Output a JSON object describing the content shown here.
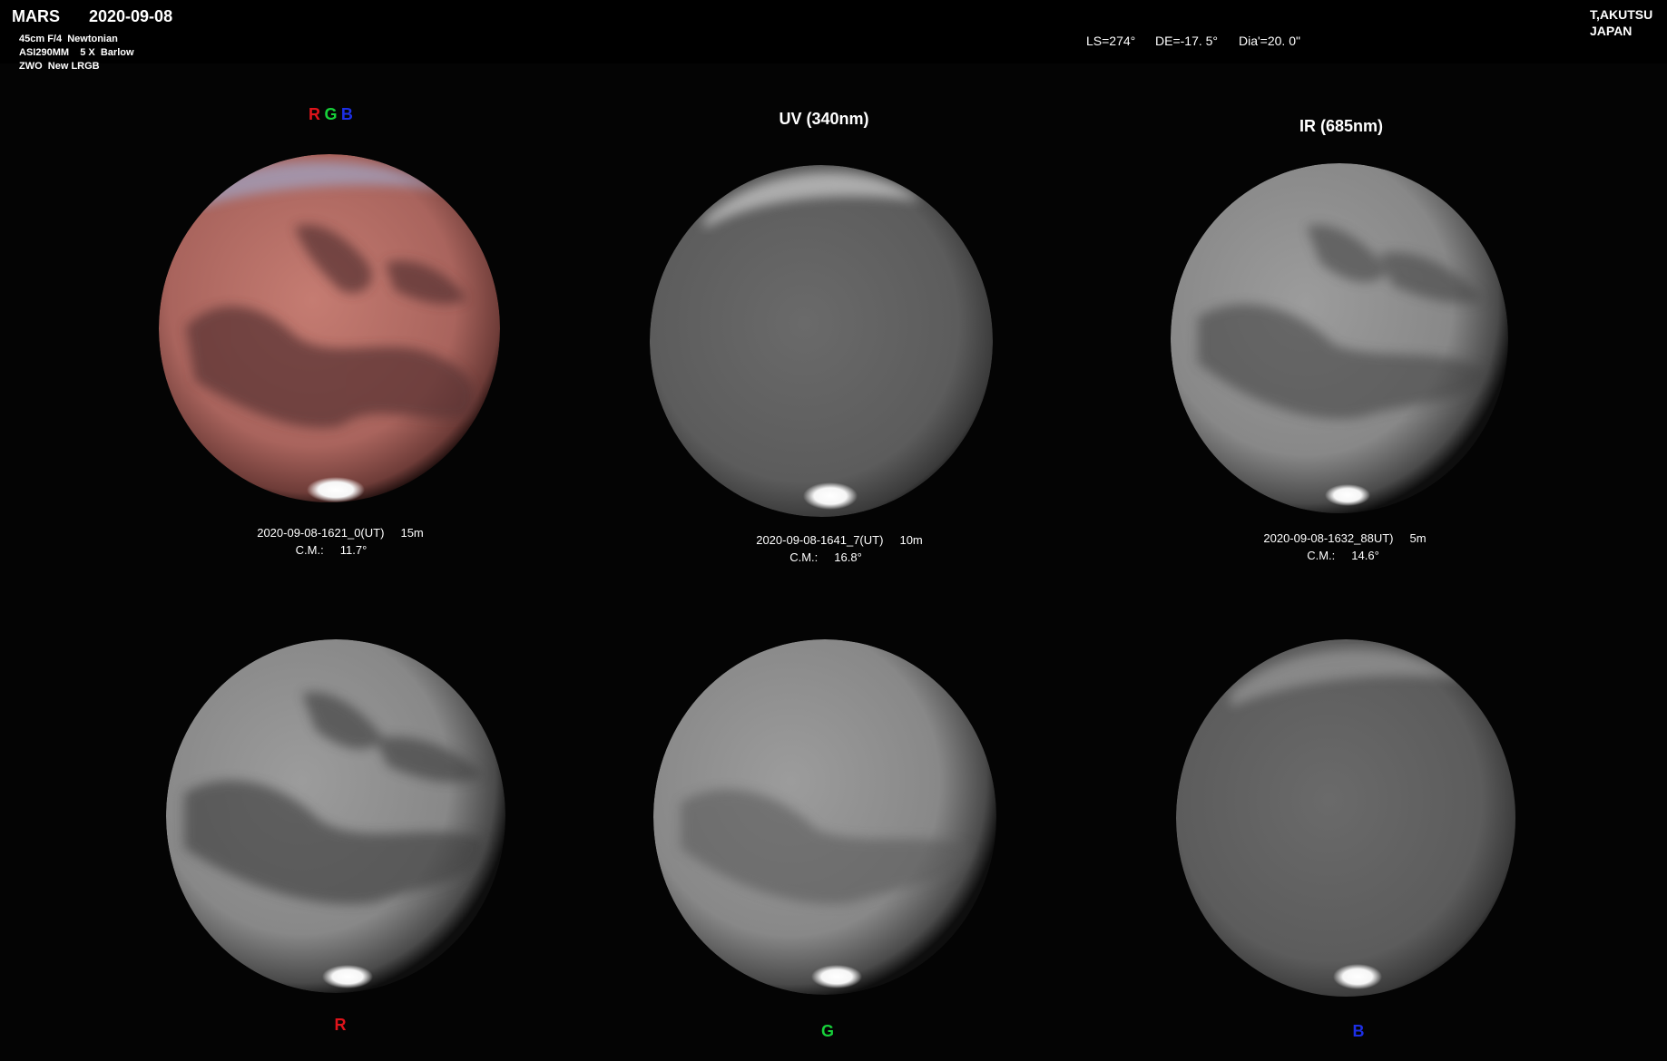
{
  "header": {
    "target": "MARS",
    "date": "2020-09-08",
    "telescope": "45cm F/4  Newtonian",
    "camera": "ASI290MM    5 X  Barlow",
    "filters": "ZWO  New LRGB",
    "ls": "LS=274°",
    "de": "DE=-17. 5°",
    "dia": "Dia'=20. 0\"",
    "observer": "T,AKUTSU",
    "country": "JAPAN"
  },
  "panels": {
    "rgb": {
      "r": "R",
      "g": "G",
      "b": "B",
      "time": "2020-09-08-1621_0(UT)     15m",
      "cm": "C.M.:     11.7°"
    },
    "uv": {
      "label": "UV (340nm)",
      "time": "2020-09-08-1641_7(UT)     10m",
      "cm": "C.M.:     16.8°"
    },
    "ir": {
      "label": "IR (685nm)",
      "time": "2020-09-08-1632_88UT)     5m",
      "cm": "C.M.:     14.6°"
    },
    "r_label": "R",
    "g_label": "G",
    "b_label": "B"
  },
  "colors": {
    "red": "#e0141b",
    "green": "#17d13a",
    "blue": "#1d2fe6",
    "mars_color": "#b9736b",
    "polar_cap": "#ffffff"
  }
}
